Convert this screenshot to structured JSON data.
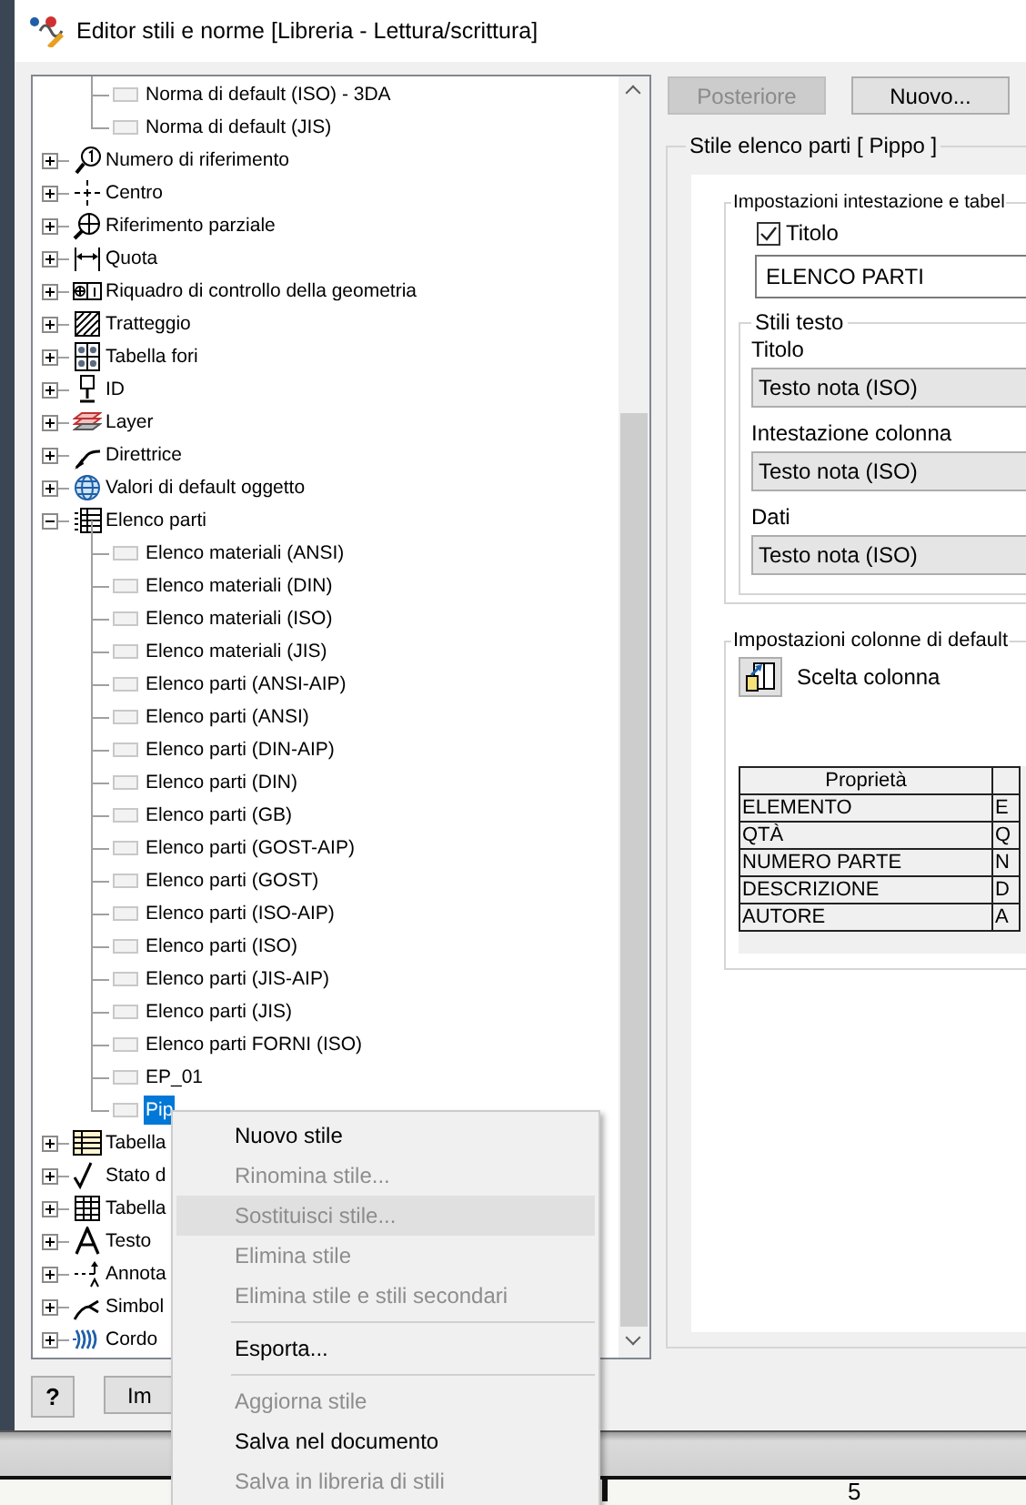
{
  "window": {
    "title": "Editor stili e norme [Libreria - Lettura/scrittura]"
  },
  "tree": {
    "scrolled_children": [
      {
        "label": "Norma di default (ISO) - 3DA",
        "selected": false
      },
      {
        "label": "Norma di default (JIS)",
        "selected": false
      }
    ],
    "items": [
      {
        "kind": "balloon",
        "label": "Numero di riferimento",
        "expanded": false
      },
      {
        "kind": "center",
        "label": "Centro",
        "expanded": false
      },
      {
        "kind": "detail",
        "label": "Riferimento parziale",
        "expanded": false
      },
      {
        "kind": "dimension",
        "label": "Quota",
        "expanded": false
      },
      {
        "kind": "frame",
        "label": "Riquadro di controllo della geometria",
        "expanded": false
      },
      {
        "kind": "hatch",
        "label": "Tratteggio",
        "expanded": false
      },
      {
        "kind": "holes",
        "label": "Tabella fori",
        "expanded": false
      },
      {
        "kind": "id",
        "label": "ID",
        "expanded": false
      },
      {
        "kind": "layer",
        "label": "Layer",
        "expanded": false
      },
      {
        "kind": "leader",
        "label": "Direttrice",
        "expanded": false
      },
      {
        "kind": "globe",
        "label": "Valori di default oggetto",
        "expanded": false
      },
      {
        "kind": "list",
        "label": "Elenco parti",
        "expanded": true,
        "children": [
          {
            "label": "Elenco materiali (ANSI)",
            "selected": false
          },
          {
            "label": "Elenco materiali (DIN)",
            "selected": false
          },
          {
            "label": "Elenco materiali (ISO)",
            "selected": false
          },
          {
            "label": "Elenco materiali (JIS)",
            "selected": false
          },
          {
            "label": "Elenco parti (ANSI-AIP)",
            "selected": false
          },
          {
            "label": "Elenco parti (ANSI)",
            "selected": false
          },
          {
            "label": "Elenco parti (DIN-AIP)",
            "selected": false
          },
          {
            "label": "Elenco parti (DIN)",
            "selected": false
          },
          {
            "label": "Elenco parti (GB)",
            "selected": false
          },
          {
            "label": "Elenco parti (GOST-AIP)",
            "selected": false
          },
          {
            "label": "Elenco parti (GOST)",
            "selected": false
          },
          {
            "label": "Elenco parti (ISO-AIP)",
            "selected": false
          },
          {
            "label": "Elenco parti (ISO)",
            "selected": false
          },
          {
            "label": "Elenco parti (JIS-AIP)",
            "selected": false
          },
          {
            "label": "Elenco parti (JIS)",
            "selected": false
          },
          {
            "label": "Elenco parti FORNI (ISO)",
            "selected": false
          },
          {
            "label": "EP_01",
            "selected": false
          },
          {
            "label": "Pip",
            "selected": true
          }
        ]
      },
      {
        "kind": "revtable",
        "label": "Tabella",
        "expanded": false
      },
      {
        "kind": "check",
        "label": "Stato d",
        "expanded": false
      },
      {
        "kind": "grid",
        "label": "Tabella",
        "expanded": false
      },
      {
        "kind": "text",
        "label": "Testo",
        "expanded": false
      },
      {
        "kind": "annotation",
        "label": "Annota",
        "expanded": false
      },
      {
        "kind": "symbol",
        "label": "Simbol",
        "expanded": false
      },
      {
        "kind": "weld",
        "label": "Cordo",
        "expanded": false
      }
    ]
  },
  "bottom_buttons": [
    {
      "kind": "help",
      "label": "?"
    },
    {
      "kind": "text",
      "label": "Im"
    }
  ],
  "toolbar": [
    {
      "label": "Posteriore",
      "disabled": true
    },
    {
      "label": "Nuovo...",
      "disabled": false
    }
  ],
  "style_group": {
    "title": "Stile elenco parti [ Pippo ]",
    "header_settings": {
      "title": "Impostazioni intestazione e tabel",
      "title_checkbox": {
        "label": "Titolo",
        "checked": true
      },
      "title_field": {
        "value": "ELENCO PARTI"
      },
      "text_styles": {
        "title": "Stili testo",
        "fields": [
          {
            "label": "Titolo",
            "value": "Testo nota (ISO)"
          },
          {
            "label": "Intestazione colonna",
            "value": "Testo nota (ISO)"
          },
          {
            "label": "Dati",
            "value": "Testo nota (ISO)"
          }
        ]
      }
    },
    "column_settings": {
      "title": "Impostazioni colonne di default",
      "button": {
        "label": "Scelta colonna"
      },
      "table": {
        "columns": [
          "Proprietà"
        ],
        "rows": [
          [
            "ELEMENTO",
            "E"
          ],
          [
            "QTÀ",
            "Q"
          ],
          [
            "NUMERO PARTE",
            "N"
          ],
          [
            "DESCRIZIONE",
            "D"
          ],
          [
            "AUTORE",
            "A"
          ]
        ]
      }
    }
  },
  "context_menu": [
    {
      "kind": "item",
      "label": "Nuovo stile",
      "disabled": false,
      "hovered": false
    },
    {
      "kind": "item",
      "label": "Rinomina stile...",
      "disabled": true,
      "hovered": false
    },
    {
      "kind": "item",
      "label": "Sostituisci stile...",
      "disabled": true,
      "hovered": true
    },
    {
      "kind": "item",
      "label": "Elimina stile",
      "disabled": true,
      "hovered": false
    },
    {
      "kind": "item",
      "label": "Elimina stile e stili secondari",
      "disabled": true,
      "hovered": false
    },
    {
      "kind": "separator"
    },
    {
      "kind": "item",
      "label": "Esporta...",
      "disabled": false,
      "hovered": false
    },
    {
      "kind": "separator"
    },
    {
      "kind": "item",
      "label": "Aggiorna stile",
      "disabled": true,
      "hovered": false
    },
    {
      "kind": "item",
      "label": "Salva nel documento",
      "disabled": false,
      "hovered": false
    },
    {
      "kind": "item",
      "label": "Salva in libreria di stili",
      "disabled": true,
      "hovered": false
    }
  ],
  "background_drawing": {
    "ruler_label": "5"
  }
}
